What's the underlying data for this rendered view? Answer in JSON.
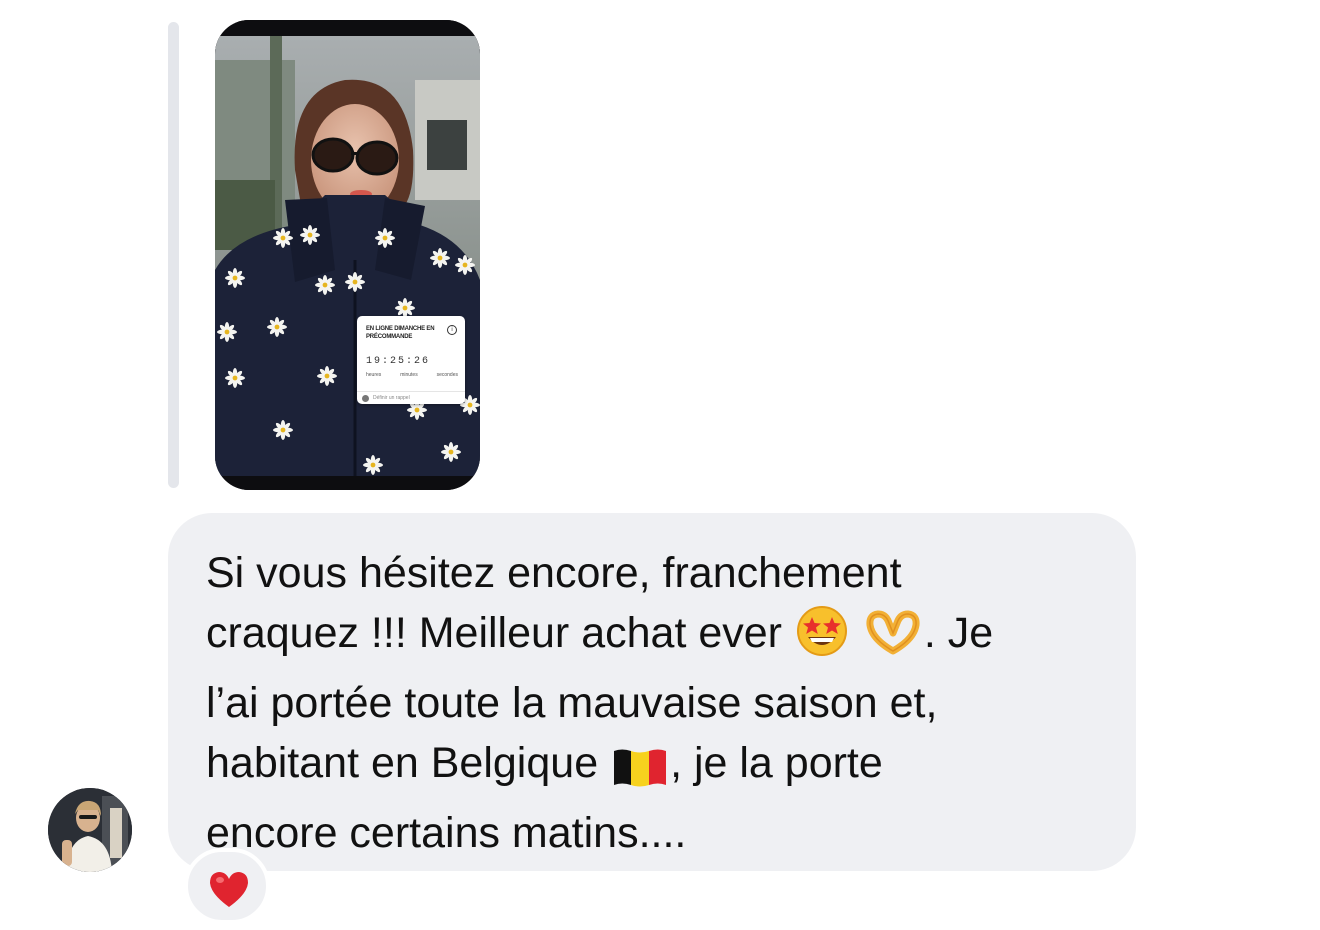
{
  "thread": {
    "reply_indicator": "reply-bar"
  },
  "story_reply": {
    "image_description_icon": "story-photo",
    "timer_sticker": {
      "title": "EN LIGNE DIMANCHE EN PRÉCOMMANDE",
      "digits": "19:25:26",
      "units": [
        "heures",
        "minutes",
        "secondes"
      ],
      "footer": "Définir un rappel"
    }
  },
  "message": {
    "sender_avatar_icon": "avatar",
    "lines": [
      "Si vous hésitez encore, franchement",
      "craquez !!! Meilleur achat ever",
      ". Je",
      "l’ai portée toute la mauvaise saison et,",
      "habitant en Belgique",
      ", je la porte",
      "encore certains matins...."
    ],
    "emojis": [
      "star-struck-emoji",
      "heart-hands-emoji",
      "belgium-flag-emoji"
    ]
  },
  "reaction": {
    "icon": "red-heart-icon"
  },
  "colors": {
    "bubble_bg": "#eff0f3",
    "reply_bar": "#e4e6eb",
    "text": "#111111",
    "heart": "#e0242f"
  }
}
